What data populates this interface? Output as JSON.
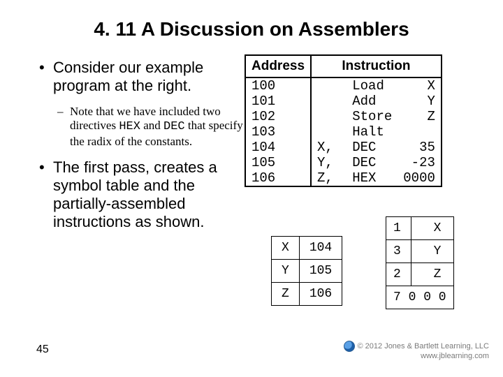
{
  "title": "4. 11 A Discussion on Assemblers",
  "bullets": {
    "b1": "Consider our example program at the right.",
    "b1_sub_pre": "Note that we have included two directives ",
    "b1_sub_hex": "HEX",
    "b1_sub_mid": " and ",
    "b1_sub_dec": "DEC",
    "b1_sub_post": " that specify the radix of the constants.",
    "b2": "The first pass, creates a symbol table and the partially-assembled instructions as shown."
  },
  "code": {
    "head_addr": "Address",
    "head_instr": "Instruction",
    "rows": [
      {
        "addr": "100",
        "lbl": "   ",
        "op": "Load ",
        "arg": "   X"
      },
      {
        "addr": "101",
        "lbl": "   ",
        "op": "Add  ",
        "arg": "   Y"
      },
      {
        "addr": "102",
        "lbl": "   ",
        "op": "Store",
        "arg": "   Z"
      },
      {
        "addr": "103",
        "lbl": "   ",
        "op": "Halt ",
        "arg": ""
      },
      {
        "addr": "104",
        "lbl": "X, ",
        "op": "DEC  ",
        "arg": "  35"
      },
      {
        "addr": "105",
        "lbl": "Y, ",
        "op": "DEC  ",
        "arg": " -23"
      },
      {
        "addr": "106",
        "lbl": "Z, ",
        "op": "HEX  ",
        "arg": "0000"
      }
    ]
  },
  "symtab": [
    {
      "s": "X",
      "a": "104"
    },
    {
      "s": "Y",
      "a": "105"
    },
    {
      "s": "Z",
      "a": "106"
    }
  ],
  "partab": [
    {
      "c0": "1",
      "c1": "  X"
    },
    {
      "c0": "3",
      "c1": "  Y"
    },
    {
      "c0": "2",
      "c1": "  Z"
    },
    {
      "c0": "7 0 0 0",
      "c1": null
    }
  ],
  "pagenum": "45",
  "credit": {
    "line1": "© 2012 Jones & Bartlett Learning, LLC",
    "line2": "www.jblearning.com"
  }
}
